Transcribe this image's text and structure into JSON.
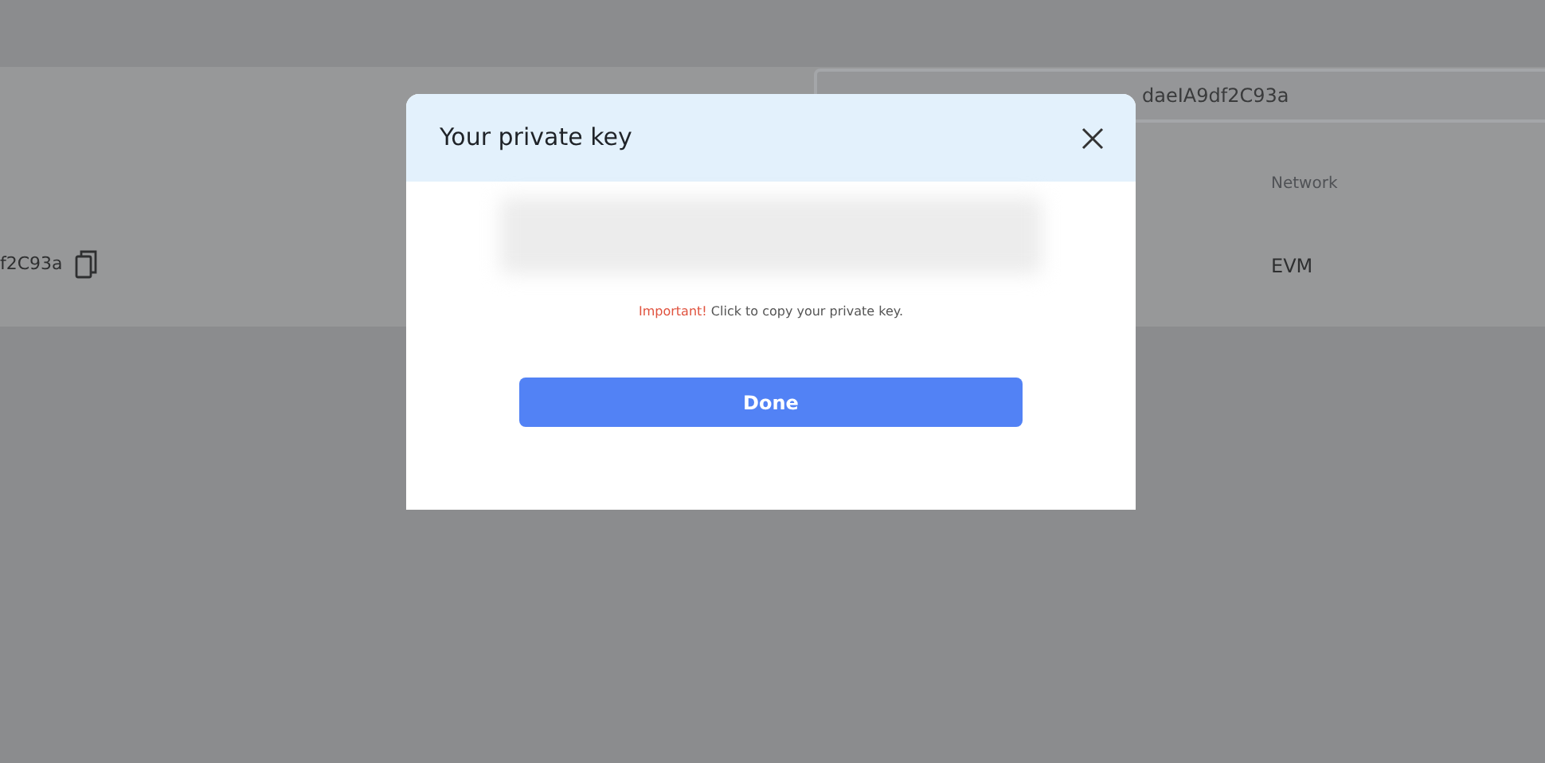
{
  "background": {
    "search_field": {
      "value": "daeIA9df2C93a"
    },
    "columns": [
      {
        "label": "Network"
      }
    ],
    "row": {
      "address": "f2C93a",
      "network": "EVM"
    }
  },
  "dialog": {
    "title": "Your private key",
    "warning": {
      "label": "Important!",
      "text": "Click to copy your private key."
    },
    "button": "Done"
  }
}
